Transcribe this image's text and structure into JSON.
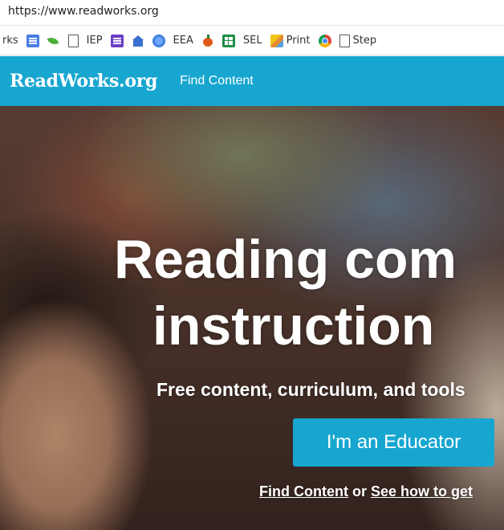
{
  "browser": {
    "url": "https://www.readworks.org",
    "bookmarks": [
      {
        "label": "rks",
        "icon": "none"
      },
      {
        "label": "",
        "icon": "docs-icon"
      },
      {
        "label": "",
        "icon": "leaf-icon"
      },
      {
        "label": "",
        "icon": "page-icon"
      },
      {
        "label": "IEP",
        "icon": "none"
      },
      {
        "label": "",
        "icon": "form-icon"
      },
      {
        "label": "",
        "icon": "school-icon"
      },
      {
        "label": "",
        "icon": "globe-icon"
      },
      {
        "label": "EEA",
        "icon": "none"
      },
      {
        "label": "",
        "icon": "apple-icon"
      },
      {
        "label": "",
        "icon": "sheet-icon"
      },
      {
        "label": "SEL",
        "icon": "none"
      },
      {
        "label": "Print",
        "icon": "print-icon"
      },
      {
        "label": "",
        "icon": "chrome-icon"
      },
      {
        "label": "Step",
        "icon": "page-icon"
      }
    ]
  },
  "header": {
    "logo": "ReadWorks.org",
    "nav_find_content": "Find Content",
    "brand_color": "#17a6d0"
  },
  "hero": {
    "title_line1": "Reading com",
    "title_line2": "instruction",
    "subtitle": "Free content, curriculum, and tools",
    "educator_button": "I'm an Educator",
    "link_find_content": "Find Content",
    "link_connector": " or ",
    "link_see_how": "See how to get"
  }
}
